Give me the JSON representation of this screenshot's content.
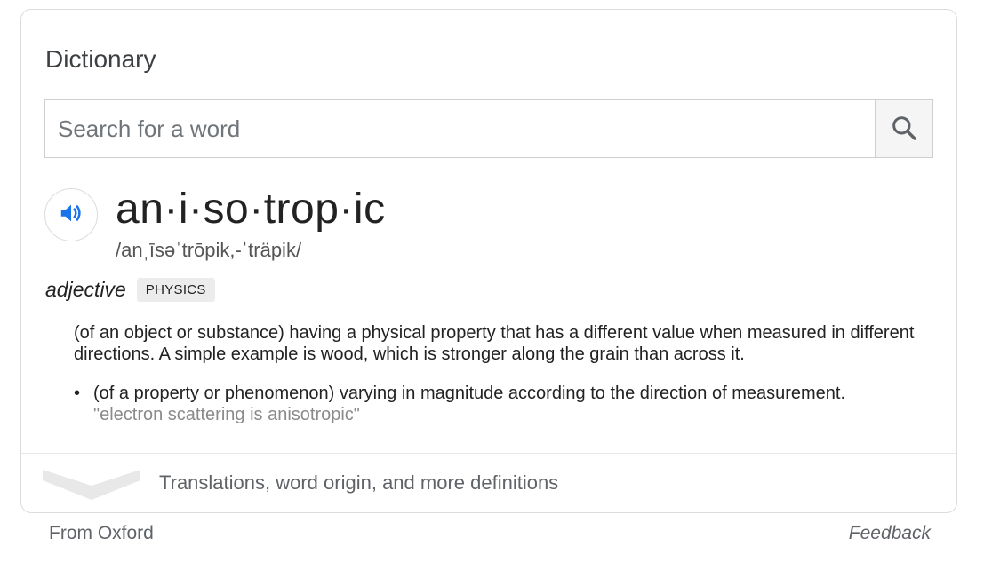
{
  "card": {
    "title": "Dictionary"
  },
  "search": {
    "placeholder": "Search for a word",
    "value": ""
  },
  "entry": {
    "headword": "an·i·so·trop·ic",
    "phonetic": "/anˌīsəˈtrōpik,-ˈträpik/",
    "part_of_speech": "adjective",
    "subject": "PHYSICS",
    "definition": "(of an object or substance) having a physical property that has a different value when measured in different directions. A simple example is wood, which is stronger along the grain than across it.",
    "sub_bullet": "•",
    "sub_definition": "(of a property or phenomenon) varying in magnitude according to the direction of measurement.",
    "example": "\"electron scattering is anisotropic\""
  },
  "more": {
    "label": "Translations, word origin, and more definitions"
  },
  "footer": {
    "source": "From Oxford",
    "feedback": "Feedback"
  },
  "colors": {
    "accent_blue": "#1a73e8",
    "border": "#dadce0",
    "muted_text": "#5f6368"
  },
  "icons": {
    "search": "search-icon",
    "speaker": "speaker-icon",
    "expand": "chevron-down-icon"
  }
}
